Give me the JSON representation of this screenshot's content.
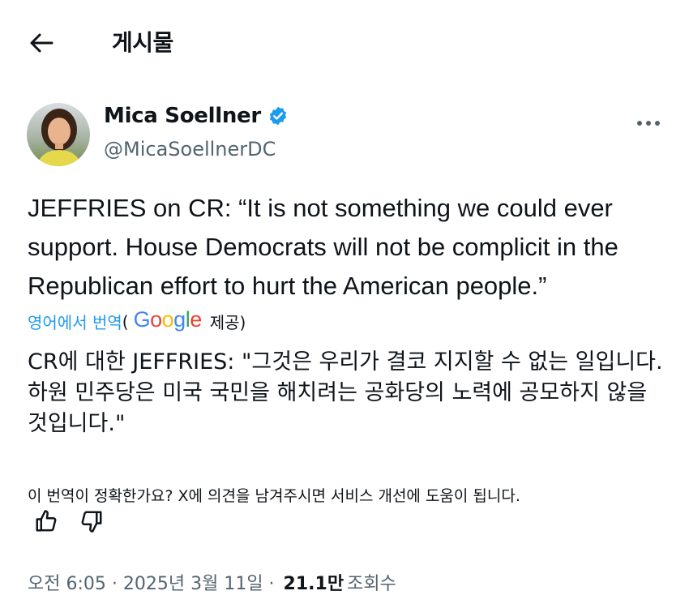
{
  "header": {
    "title": "게시물"
  },
  "author": {
    "name": "Mica Soellner",
    "handle": "@MicaSoellnerDC",
    "verified": true
  },
  "tweet": {
    "text": "JEFFRIES on CR: “It is not something we could ever support. House Democrats will not be complicit in the Republican effort to hurt the American people.”"
  },
  "translation": {
    "link_label": "영어에서 번역",
    "open_paren": "(",
    "provider_logo": "Google",
    "provided_label": "제공)",
    "text": "CR에 대한 JEFFRIES: \"그것은 우리가 결코 지지할 수 없는 일입니다. 하원 민주당은 미국 국민을 해치려는 공화당의 노력에 공모하지 않을 것입니다.\"",
    "feedback_question": "이 번역이 정확한가요? X에 의견을 남겨주시면 서비스 개선에 도움이 됩니다."
  },
  "meta": {
    "time": "오전 6:05",
    "separator": " · ",
    "date": "2025년 3월 11일",
    "views_count": "21.1만",
    "views_label": "조회수"
  },
  "colors": {
    "accent": "#1d9bf0",
    "secondary_text": "#536471",
    "primary_text": "#0f1419"
  },
  "icons": [
    "back-arrow-icon",
    "verified-badge-icon",
    "more-icon",
    "thumbs-up-icon",
    "thumbs-down-icon"
  ]
}
